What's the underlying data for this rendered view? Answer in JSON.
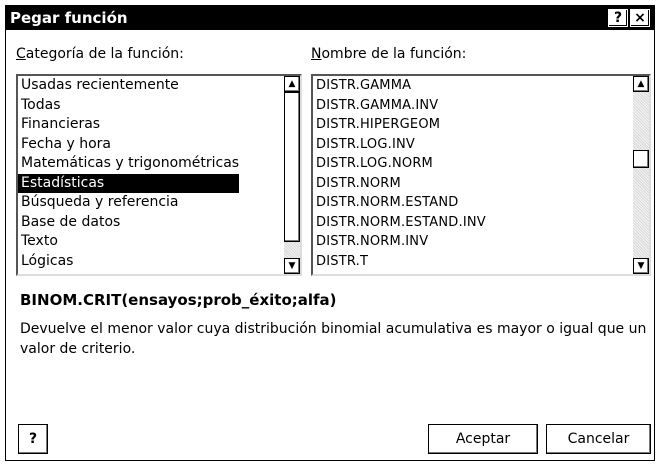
{
  "window": {
    "title": "Pegar función",
    "help_label": "?",
    "close_label": "×"
  },
  "category": {
    "label_accel": "C",
    "label_rest": "ategoría de la función:",
    "items": [
      "Usadas recientemente",
      "Todas",
      "Financieras",
      "Fecha y hora",
      "Matemáticas y trigonométricas",
      "Estadísticas",
      "Búsqueda y referencia",
      "Base de datos",
      "Texto",
      "Lógicas"
    ],
    "selected_index": 5
  },
  "functions": {
    "label_accel": "N",
    "label_rest": "ombre de la función:",
    "items": [
      "DISTR.GAMMA",
      "DISTR.GAMMA.INV",
      "DISTR.HIPERGEOM",
      "DISTR.LOG.INV",
      "DISTR.LOG.NORM",
      "DISTR.NORM",
      "DISTR.NORM.ESTAND",
      "DISTR.NORM.ESTAND.INV",
      "DISTR.NORM.INV",
      "DISTR.T"
    ]
  },
  "syntax": "BINOM.CRIT(ensayos;prob_éxito;alfa)",
  "description": "Devuelve el menor valor cuya distribución binomial acumulativa es mayor o igual que un valor de criterio.",
  "buttons": {
    "help": "?",
    "ok": "Aceptar",
    "cancel": "Cancelar"
  },
  "scroll": {
    "up_arrow": "▲",
    "down_arrow": "▼"
  }
}
